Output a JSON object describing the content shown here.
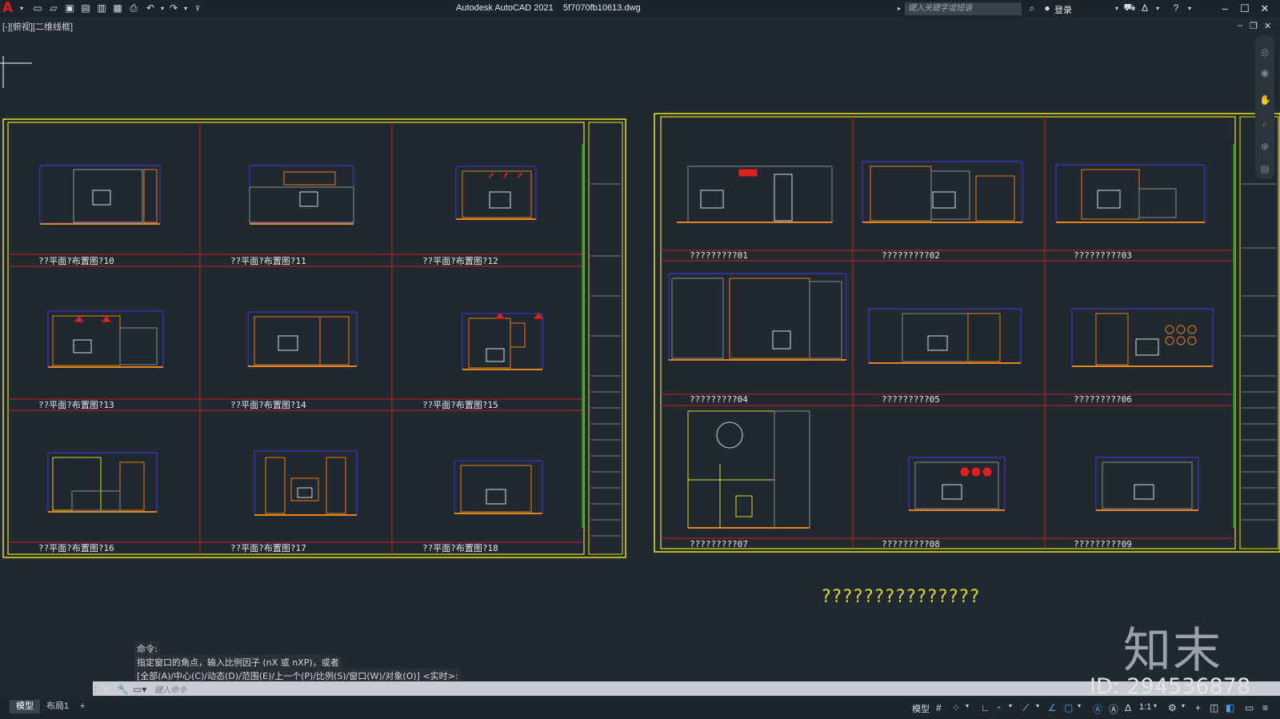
{
  "app": {
    "title": "Autodesk AutoCAD 2021",
    "filename": "5f7070fb10613.dwg"
  },
  "toolbar": {
    "search_placeholder": "键入关键字或短语",
    "login_label": "登录"
  },
  "viewport": {
    "label": "[-][俯视][二维线框]"
  },
  "sheets": {
    "left": {
      "titles": [
        "??平面?布置图?10",
        "??平面?布置图?11",
        "??平面?布置图?12",
        "??平面?布置图?13",
        "??平面?布置图?14",
        "??平面?布置图?15",
        "??平面?布置图?16",
        "??平面?布置图?17",
        "??平面?布置图?18"
      ]
    },
    "right": {
      "titles": [
        "?????????01",
        "?????????02",
        "?????????03",
        "?????????04",
        "?????????05",
        "?????????06",
        "?????????07",
        "?????????08",
        "?????????09"
      ]
    },
    "caption": "???????????????"
  },
  "command": {
    "history": [
      "命令:",
      "指定窗口的角点，输入比例因子 (nX 或 nXP)，或者",
      "[全部(A)/中心(C)/动态(D)/范围(E)/上一个(P)/比例(S)/窗口(W)/对象(O)] <实时>:"
    ],
    "input_placeholder": "键入命令"
  },
  "layout_tabs": {
    "model": "模型",
    "layout1": "布局1",
    "add": "+"
  },
  "statusbar": {
    "model_label": "模型",
    "scale_label": "1:1"
  },
  "watermark": {
    "logo": "知末",
    "id": "ID: 294536878"
  },
  "colors": {
    "background": "#212830",
    "sheet_border": "#e6e619",
    "section_line": "#d21e1e",
    "wall_orange": "#e0851e",
    "dim_yellow": "#d9d92b",
    "blue_line": "#3c3cdc"
  }
}
